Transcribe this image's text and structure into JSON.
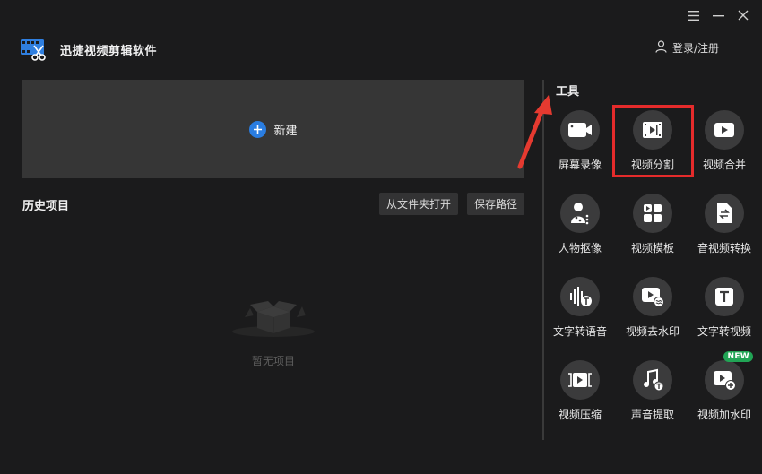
{
  "app": {
    "title": "迅捷视频剪辑软件"
  },
  "window_controls": [
    {
      "name": "menu-icon"
    },
    {
      "name": "minimize-icon"
    },
    {
      "name": "close-icon"
    }
  ],
  "header": {
    "login_label": "登录/注册"
  },
  "new_panel": {
    "label": "新建"
  },
  "history": {
    "title": "历史项目",
    "open_folder_label": "从文件夹打开",
    "save_path_label": "保存路径",
    "empty_text": "暂无项目"
  },
  "tools": {
    "title": "工具",
    "items": [
      {
        "label": "屏幕录像",
        "icon": "camera-icon"
      },
      {
        "label": "视频分割",
        "icon": "film-split-icon"
      },
      {
        "label": "视频合并",
        "icon": "play-icon"
      },
      {
        "label": "人物抠像",
        "icon": "person-cutout-icon"
      },
      {
        "label": "视频模板",
        "icon": "template-icon"
      },
      {
        "label": "音视频转换",
        "icon": "convert-icon"
      },
      {
        "label": "文字转语音",
        "icon": "text-to-speech-icon"
      },
      {
        "label": "视频去水印",
        "icon": "remove-watermark-icon"
      },
      {
        "label": "文字转视频",
        "icon": "text-icon"
      },
      {
        "label": "视频压缩",
        "icon": "compress-icon"
      },
      {
        "label": "声音提取",
        "icon": "music-note-icon"
      },
      {
        "label": "视频加水印",
        "icon": "add-watermark-icon",
        "badge": "NEW"
      }
    ]
  },
  "colors": {
    "accent_blue": "#2a7de1",
    "highlight_red": "#e52b2b",
    "badge_green": "#21a455"
  }
}
